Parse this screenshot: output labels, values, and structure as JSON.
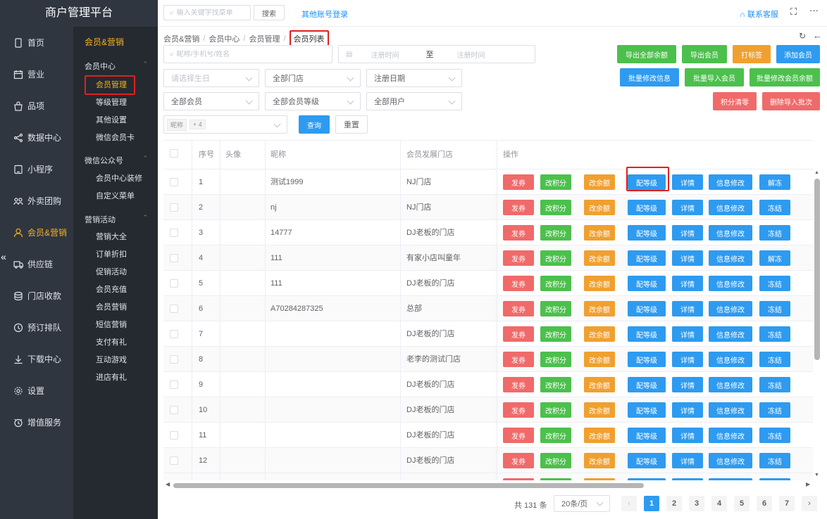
{
  "app_title": "商户管理平台",
  "main_nav": [
    {
      "label": "首页",
      "icon": "phone-icon"
    },
    {
      "label": "营业",
      "icon": "calendar-icon"
    },
    {
      "label": "品项",
      "icon": "bag-icon"
    },
    {
      "label": "数据中心",
      "icon": "share-icon"
    },
    {
      "label": "小程序",
      "icon": "mobile-icon"
    },
    {
      "label": "外卖团购",
      "icon": "group-icon"
    },
    {
      "label": "会员&营销",
      "icon": "user-icon",
      "active": true
    },
    {
      "label": "供应链",
      "icon": "truck-icon"
    },
    {
      "label": "门店收款",
      "icon": "database-icon"
    },
    {
      "label": "预订排队",
      "icon": "clock-icon"
    },
    {
      "label": "下载中心",
      "icon": "download-icon"
    },
    {
      "label": "设置",
      "icon": "gear-icon"
    },
    {
      "label": "增值服务",
      "icon": "alarm-icon"
    }
  ],
  "sub_nav": {
    "section": "会员&营销",
    "groups": [
      {
        "title": "会员中心",
        "items": [
          "会员管理",
          "等级管理",
          "其他设置",
          "微信会员卡"
        ]
      },
      {
        "title": "微信公众号",
        "items": [
          "会员中心装修",
          "自定义菜单"
        ]
      },
      {
        "title": "营销活动",
        "items": [
          "营销大全",
          "订单折扣",
          "促销活动",
          "会员充值",
          "会员营销",
          "短信营销",
          "支付有礼",
          "互动游戏",
          "进店有礼"
        ]
      }
    ],
    "active_item": "会员管理"
  },
  "topbar": {
    "search_placeholder": "输入关键字找菜单",
    "search_button": "搜索",
    "other_login": "其他账号登录",
    "contact": "联系客服"
  },
  "breadcrumb": [
    "会员&营销",
    "会员中心",
    "会员管理",
    "会员列表"
  ],
  "filters": {
    "name_placeholder": "昵称/手机号/姓名",
    "reg_start_placeholder": "注册时间",
    "to_label": "至",
    "reg_end_placeholder": "注册时间",
    "birthday_placeholder": "请选择生日",
    "store": "全部门店",
    "reg_date": "注册日期",
    "member_type": "全部会员",
    "member_level": "全部会员等级",
    "user_type": "全部用户",
    "tag_label": "昵称",
    "tag_more": "+ 4",
    "query_button": "查询",
    "reset_button": "重置"
  },
  "actions": {
    "export_balance": "导出全部余额",
    "export_member": "导出会员",
    "tag": "打标签",
    "add_member": "添加会员",
    "batch_edit_info": "批量修改信息",
    "batch_import": "批量导入会员",
    "batch_edit_balance": "批量修改会员余额",
    "clear_points": "积分清零",
    "delete_import_batch": "删除导入批次"
  },
  "colors": {
    "sidebar": "#2f3640",
    "accent": "#f5b21b",
    "primary": "#2e9bf0",
    "success": "#4cc04c",
    "warning": "#f0a030",
    "danger": "#f06a6a"
  },
  "table": {
    "headers": {
      "index": "序号",
      "avatar": "头像",
      "nickname": "昵称",
      "store": "会员发展门店",
      "ops": "操作"
    },
    "op_labels": {
      "coupon": "发券",
      "points": "改积分",
      "balance": "改余额",
      "level": "配等级",
      "detail": "详情",
      "edit": "信息修改"
    },
    "rows": [
      {
        "index": "1",
        "nickname": "测试1999",
        "store": "NJ门店",
        "freeze": "解冻"
      },
      {
        "index": "2",
        "nickname": "nj",
        "store": "NJ门店",
        "freeze": "冻结"
      },
      {
        "index": "3",
        "nickname": "14777",
        "store": "DJ老板的门店",
        "freeze": "冻结"
      },
      {
        "index": "4",
        "nickname": "111",
        "store": "有家小店叫童年",
        "freeze": "解冻"
      },
      {
        "index": "5",
        "nickname": "111",
        "store": "DJ老板的门店",
        "freeze": "冻结"
      },
      {
        "index": "6",
        "nickname": "A70284287325",
        "store": "总部",
        "freeze": "冻结"
      },
      {
        "index": "7",
        "nickname": "",
        "store": "DJ老板的门店",
        "freeze": "冻结"
      },
      {
        "index": "8",
        "nickname": "",
        "store": "老李的测试门店",
        "freeze": "冻结"
      },
      {
        "index": "9",
        "nickname": "",
        "store": "DJ老板的门店",
        "freeze": "冻结"
      },
      {
        "index": "10",
        "nickname": "",
        "store": "DJ老板的门店",
        "freeze": "冻结"
      },
      {
        "index": "11",
        "nickname": "",
        "store": "DJ老板的门店",
        "freeze": "冻结"
      },
      {
        "index": "12",
        "nickname": "",
        "store": "DJ老板的门店",
        "freeze": "冻结"
      }
    ]
  },
  "pagination": {
    "total": "共 131 条",
    "page_size": "20条/页",
    "pages": [
      "1",
      "2",
      "3",
      "4",
      "5",
      "6",
      "7"
    ],
    "current": "1"
  }
}
